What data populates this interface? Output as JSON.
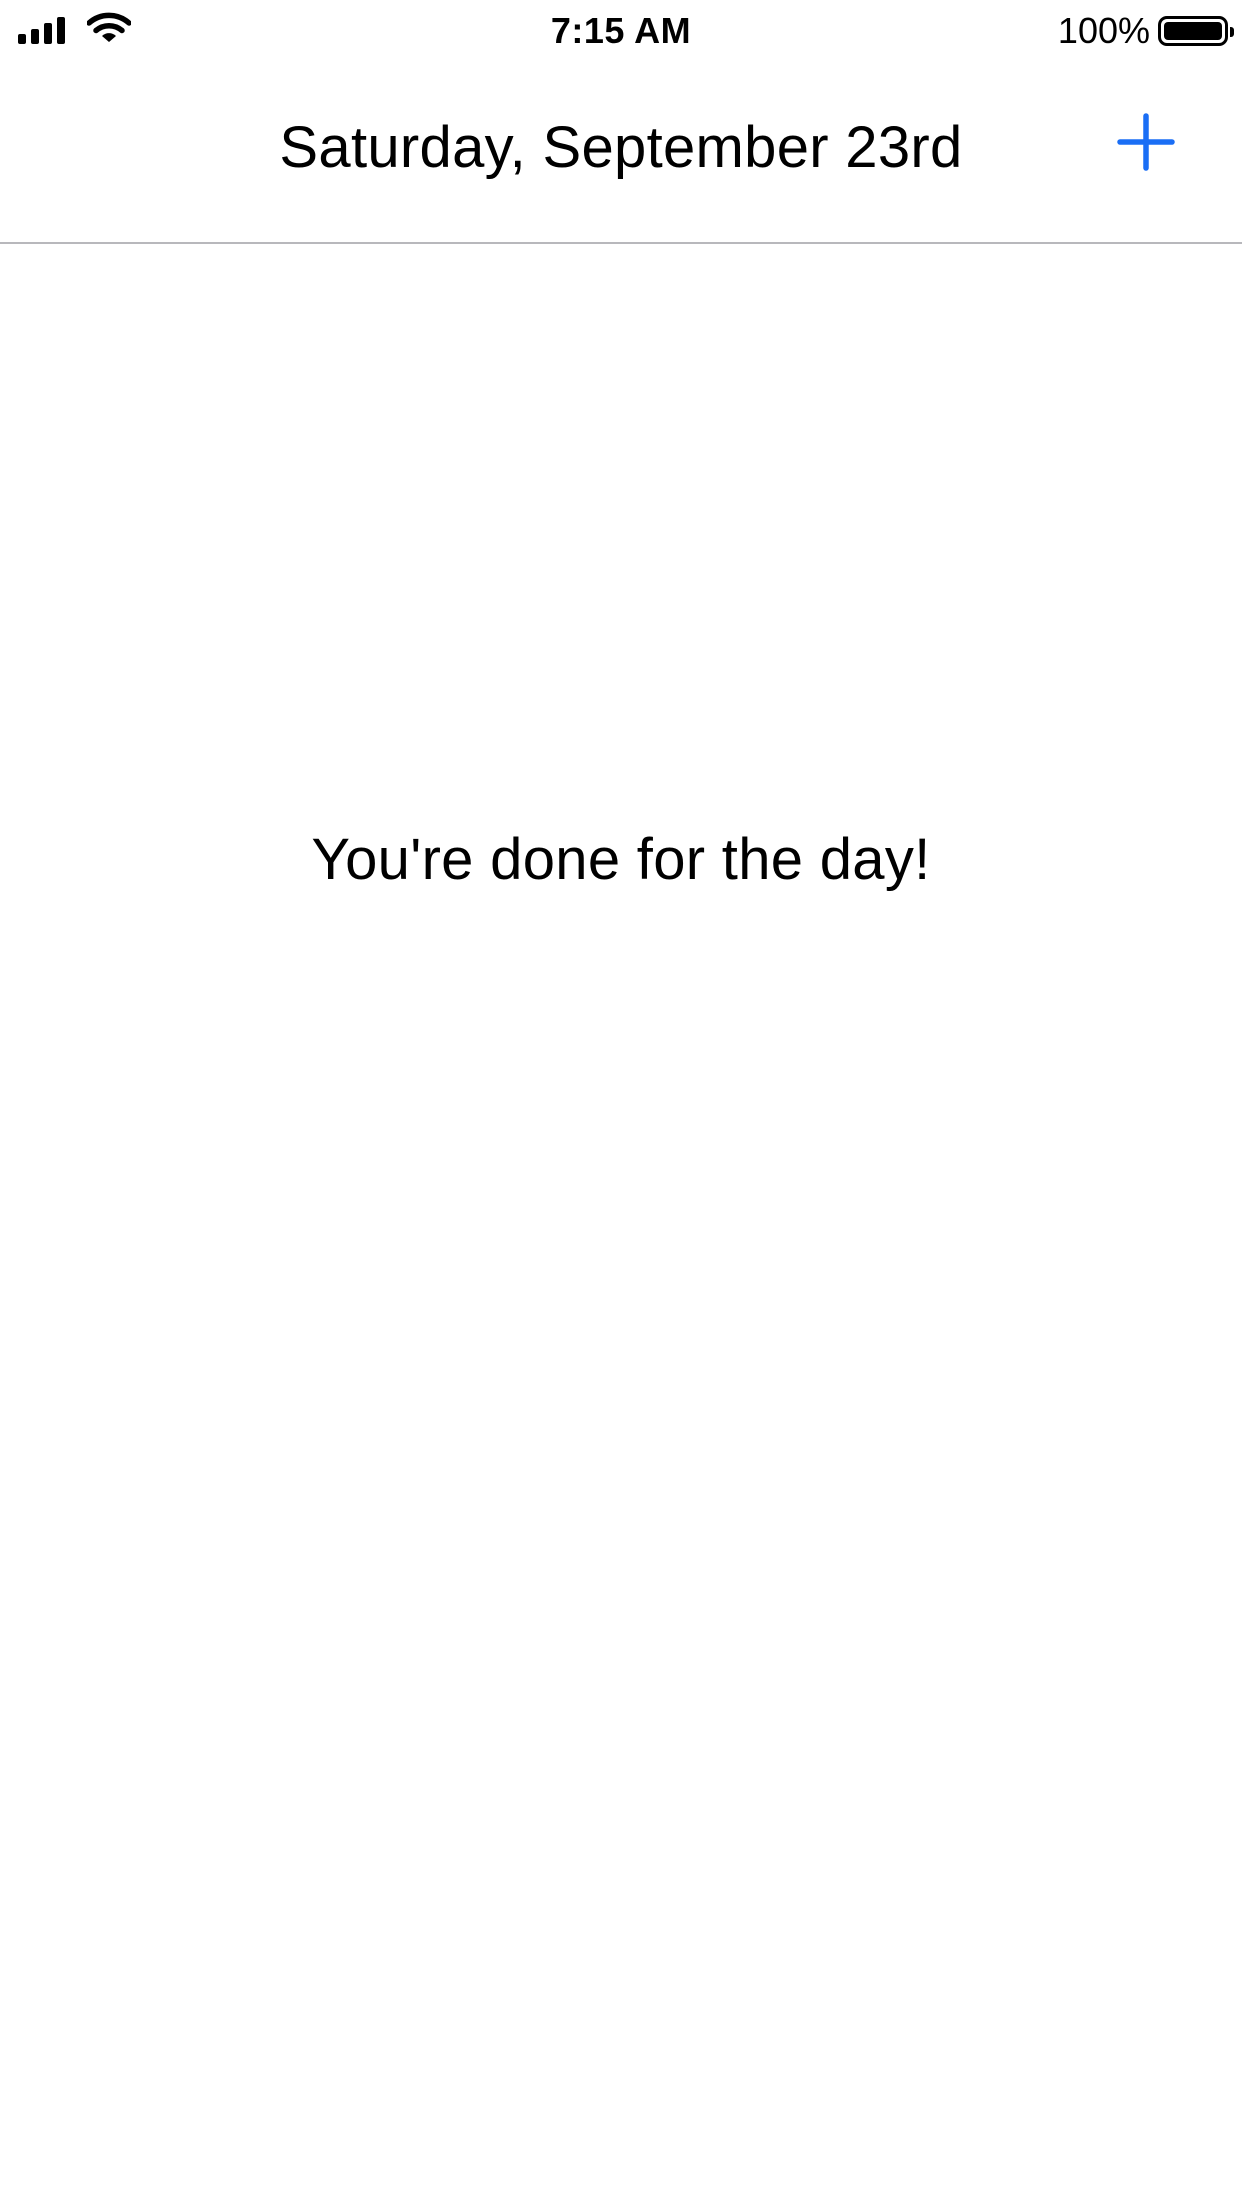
{
  "status_bar": {
    "time": "7:15 AM",
    "battery_percent": "100%",
    "battery_level": 1.0,
    "signal_icon": "cellular-signal-icon",
    "wifi_icon": "wifi-icon",
    "battery_icon": "battery-icon"
  },
  "nav": {
    "title": "Saturday, September 23rd",
    "add_icon": "plus-icon",
    "accent_color": "#1a6ef5"
  },
  "main": {
    "empty_message": "You're done for the day!"
  }
}
